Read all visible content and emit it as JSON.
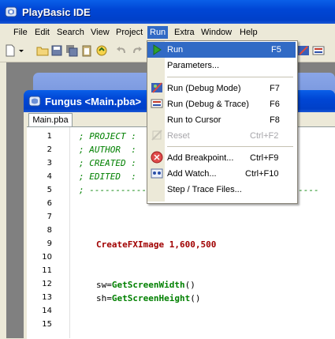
{
  "app": {
    "title": "PlayBasic IDE"
  },
  "menubar": {
    "items": [
      "File",
      "Edit",
      "Search",
      "View",
      "Project",
      "Run",
      "Extra",
      "Window",
      "Help"
    ]
  },
  "window": {
    "title": "Fungus <Main.pba>",
    "tab": "Main.pba"
  },
  "editor": {
    "line_numbers": [
      "1",
      "2",
      "3",
      "4",
      "5",
      "6",
      "7",
      "8",
      "9",
      "10",
      "11",
      "12",
      "13",
      "14",
      "15"
    ],
    "lines": {
      "l1": "; PROJECT :",
      "l2": "; AUTHOR  :",
      "l3": "; CREATED :",
      "l4": "; EDITED  :",
      "l5": "; --------------------------------------------",
      "l9_fn": "CreateFXImage",
      "l9_args": " 1,600,500",
      "l12_var": "sw=",
      "l12_fn": "GetScreenWidth",
      "l12_end": "()",
      "l13_var": "sh=",
      "l13_fn": "GetScreenHeight",
      "l13_end": "()"
    }
  },
  "run_menu": {
    "items": [
      {
        "label": "Run",
        "shortcut": "F5"
      },
      {
        "label": "Parameters...",
        "shortcut": ""
      },
      {
        "label": "Run (Debug Mode)",
        "shortcut": "F7"
      },
      {
        "label": "Run (Debug & Trace)",
        "shortcut": "F6"
      },
      {
        "label": "Run to Cursor",
        "shortcut": "F8"
      },
      {
        "label": "Reset",
        "shortcut": "Ctrl+F2"
      },
      {
        "label": "Add Breakpoint...",
        "shortcut": "Ctrl+F9"
      },
      {
        "label": "Add Watch...",
        "shortcut": "Ctrl+F10"
      },
      {
        "label": "Step / Trace Files...",
        "shortcut": ""
      }
    ]
  },
  "colors": {
    "xp_blue": "#0046d5",
    "menu_highlight": "#316ac5",
    "comment": "#008000",
    "function": "#a00000"
  }
}
